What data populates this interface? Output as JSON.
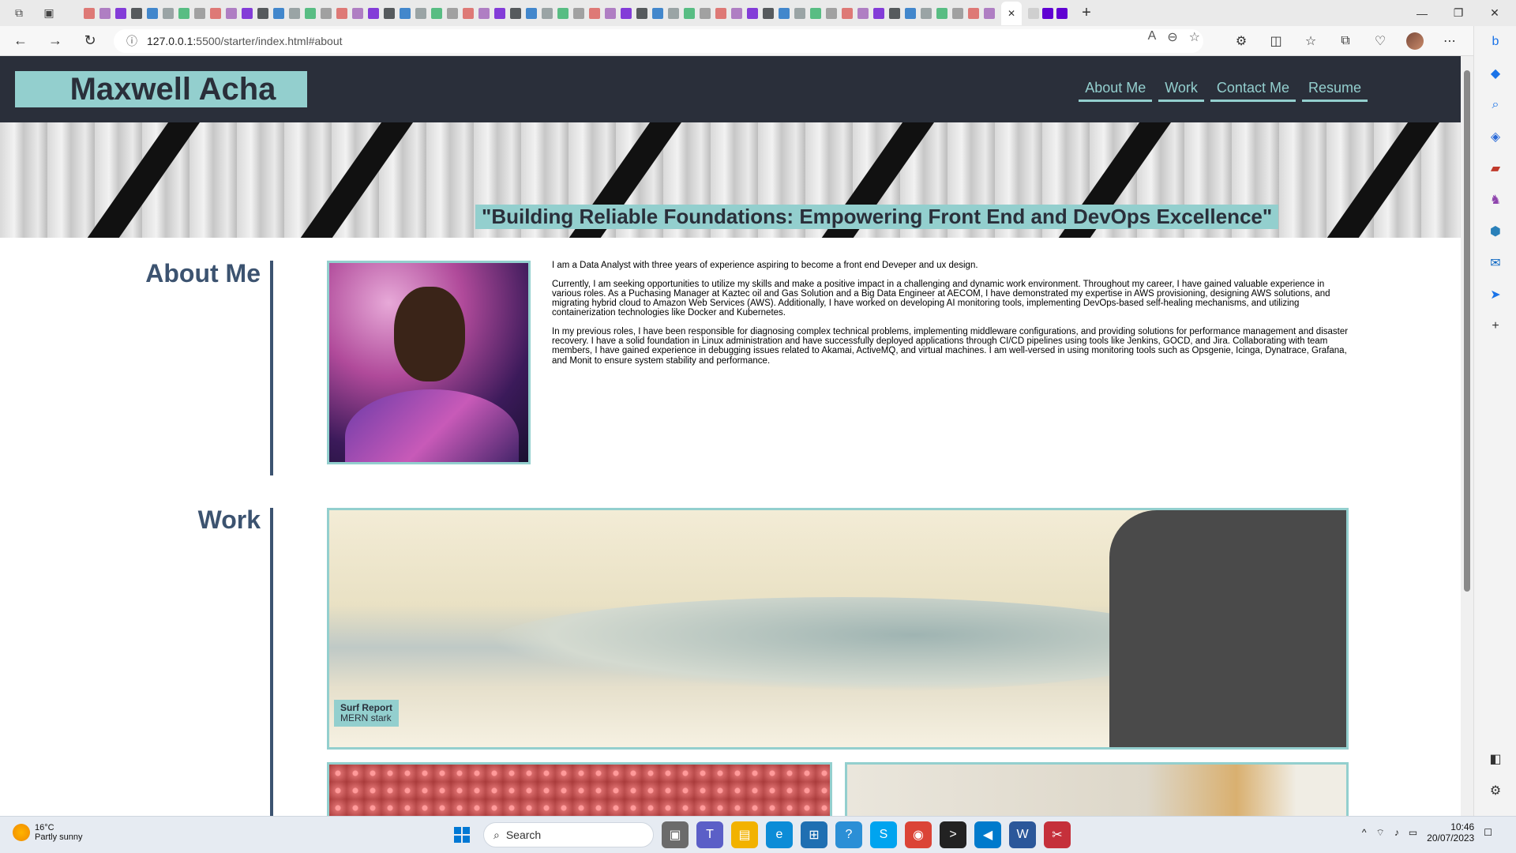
{
  "browser": {
    "url_host": "127.0.0.1:",
    "url_path": "5500/starter/index.html#about",
    "new_tab": "+",
    "minimize": "—",
    "restore": "❐",
    "close": "✕",
    "tab_close": "✕"
  },
  "site": {
    "brand": "Maxwell Acha",
    "nav": [
      "About Me",
      "Work",
      "Contact Me",
      "Resume"
    ],
    "hero_quote": "\"Building Reliable Foundations: Empowering Front End and DevOps Excellence\""
  },
  "about": {
    "title": "About Me",
    "paragraphs": [
      "I am a Data Analyst with three years of experience aspiring to become a front end Deveper and ux design.",
      "Currently, I am seeking opportunities to utilize my skills and make a positive impact in a challenging and dynamic work environment. Throughout my career, I have gained valuable experience in various roles. As a Puchasing Manager at Kaztec oil and Gas Solution and a Big Data Engineer at AECOM, I have demonstrated my expertise in AWS provisioning, designing AWS solutions, and migrating hybrid cloud to Amazon Web Services (AWS). Additionally, I have worked on developing AI monitoring tools, implementing DevOps-based self-healing mechanisms, and utilizing containerization technologies like Docker and Kubernetes.",
      "In my previous roles, I have been responsible for diagnosing complex technical problems, implementing middleware configurations, and providing solutions for performance management and disaster recovery. I have a solid foundation in Linux administration and have successfully deployed applications through CI/CD pipelines using tools like Jenkins, GOCD, and Jira. Collaborating with team members, I have gained experience in debugging issues related to Akamai, ActiveMQ, and virtual machines. I am well-versed in using monitoring tools such as Opsgenie, Icinga, Dynatrace, Grafana, and Monit to ensure system stability and performance."
    ]
  },
  "work": {
    "title": "Work",
    "featured": {
      "name": "Surf Report",
      "subtitle": "MERN stark"
    }
  },
  "taskbar": {
    "temperature": "16°C",
    "weather": "Partly sunny",
    "search_placeholder": "Search",
    "time": "10:46",
    "date": "20/07/2023"
  },
  "colors": {
    "accent": "#93cfce",
    "header_bg": "#2a2f3a",
    "heading": "#3c5370"
  }
}
